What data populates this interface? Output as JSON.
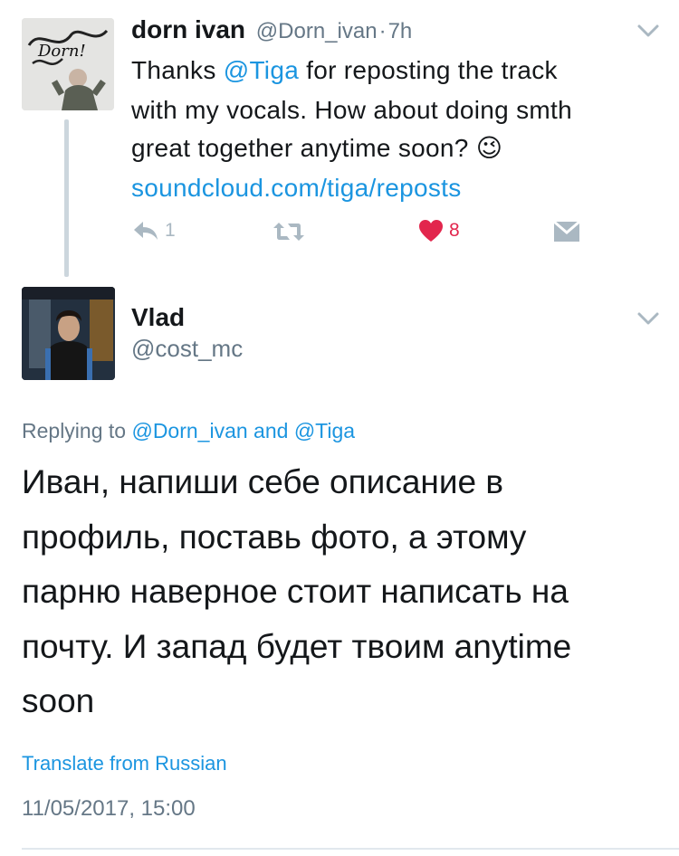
{
  "parent_tweet": {
    "name": "dorn ivan",
    "handle": "@Dorn_ivan",
    "separator": "·",
    "time": "7h",
    "text_thanks": "Thanks",
    "text_mention": "@Tiga",
    "text_after_mention": " for reposting the track",
    "line2": "with my vocals. How about doing smth",
    "line3": "great together anytime soon?",
    "emoji": "😉",
    "link": "soundcloud.com/tiga/reposts",
    "reply_count": "1",
    "like_count": "8",
    "avatar_graffiti_text": "Dorn!"
  },
  "main_tweet": {
    "name": "Vlad",
    "handle": "@cost_mc",
    "replying_prefix": "Replying to",
    "replying_user1": "@Dorn_ivan",
    "replying_and": "and",
    "replying_user2": "@Tiga",
    "body_lines": [
      "Иван, напиши себе описание в",
      "профиль, поставь фото, а этому",
      "парню наверное стоит написать на",
      "почту. И запад будет твоим anytime",
      "soon"
    ],
    "translate": "Translate from Russian",
    "timestamp": "11/05/2017, 15:00"
  },
  "colors": {
    "link": "#1b95e0",
    "muted": "#657786",
    "icon": "#aab8c2",
    "like": "#e2264d",
    "divider": "#e1e8ed",
    "thread_line": "#ccd6dd"
  }
}
